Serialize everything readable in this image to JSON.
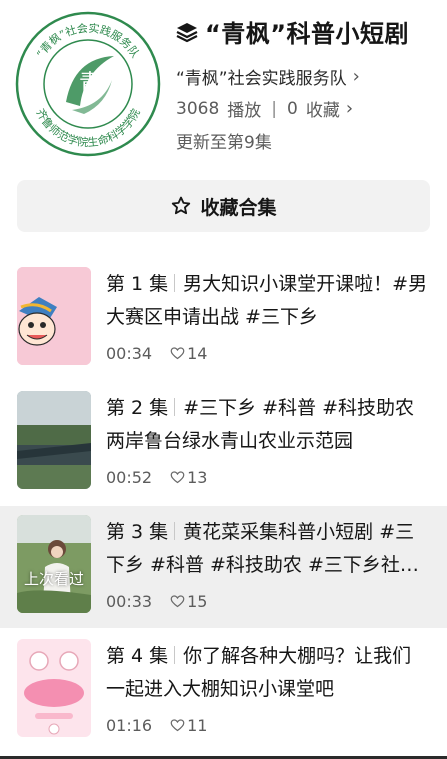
{
  "collection": {
    "title": "“青枫”科普小短剧",
    "team": "“青枫”社会实践服务队",
    "plays": "3068",
    "plays_label": "播放",
    "favorites": "0",
    "favorites_label": "收藏",
    "update_text": "更新至第9集",
    "logo_char": "青",
    "logo_arc_top": "“青枫”社会实践服务队",
    "logo_arc_bottom": "齐鲁师范学院生命科学学院",
    "colors": {
      "logo_green": "#2f8a4e"
    }
  },
  "collect_button": {
    "label": "收藏合集"
  },
  "episodes": [
    {
      "label": "第 1 集",
      "title": "男大知识小课堂开课啦！#男大赛区申请出战 #三下乡",
      "duration": "00:34",
      "likes": "14"
    },
    {
      "label": "第 2 集",
      "title": "#三下乡 #科普 #科技助农 两岸鲁台绿水青山农业示范园",
      "duration": "00:52",
      "likes": "13"
    },
    {
      "label": "第 3 集",
      "title": "黄花菜采集科普小短剧 #三下乡 #科普 #科技助农 #三下乡社会实践",
      "duration": "00:33",
      "likes": "15",
      "watched_label": "上次看过"
    },
    {
      "label": "第 4 集",
      "title": "你了解各种大棚吗？让我们一起进入大棚知识小课堂吧",
      "duration": "01:16",
      "likes": "11"
    }
  ]
}
